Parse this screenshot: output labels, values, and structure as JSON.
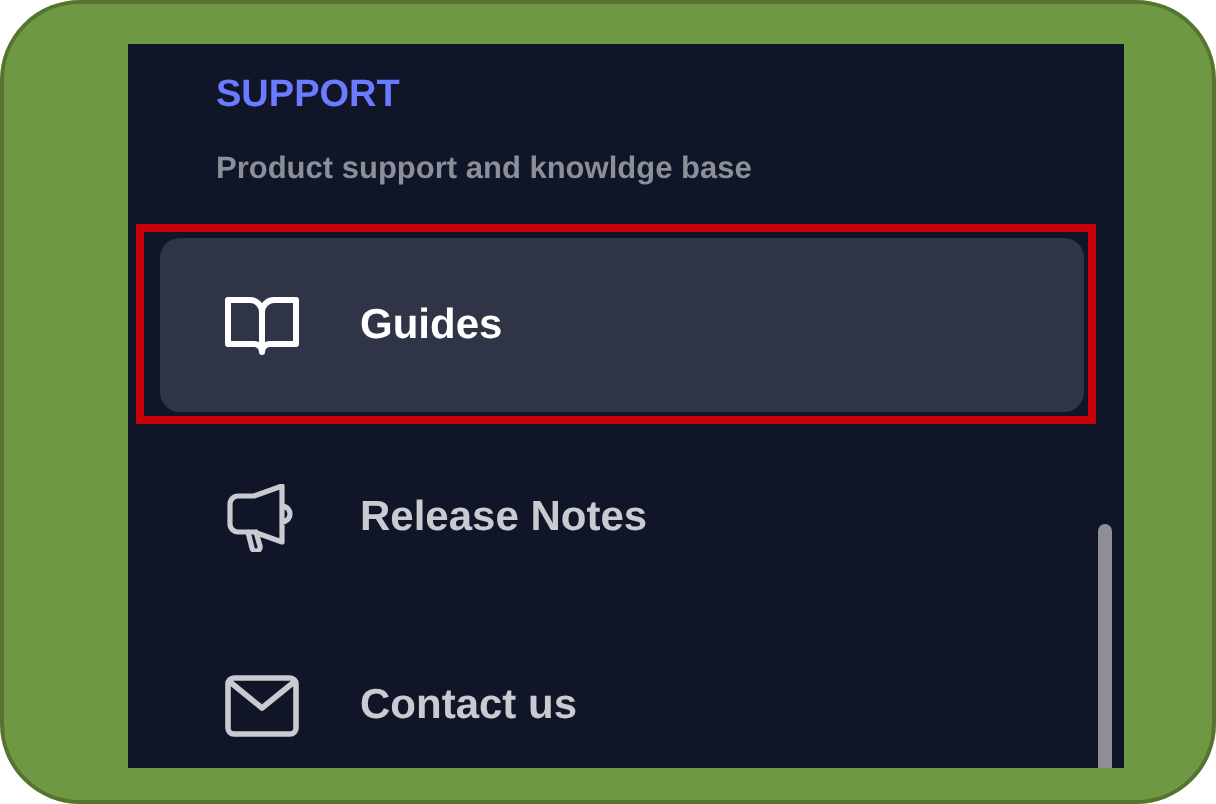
{
  "section": {
    "title": "SUPPORT",
    "subtitle": "Product support and knowldge base"
  },
  "items": [
    {
      "kind": "docs",
      "label": "Guides",
      "selected": true,
      "highlighted": true
    },
    {
      "kind": "news",
      "label": "Release Notes",
      "selected": false,
      "highlighted": false
    },
    {
      "kind": "mail",
      "label": "Contact us",
      "selected": false,
      "highlighted": false
    }
  ]
}
